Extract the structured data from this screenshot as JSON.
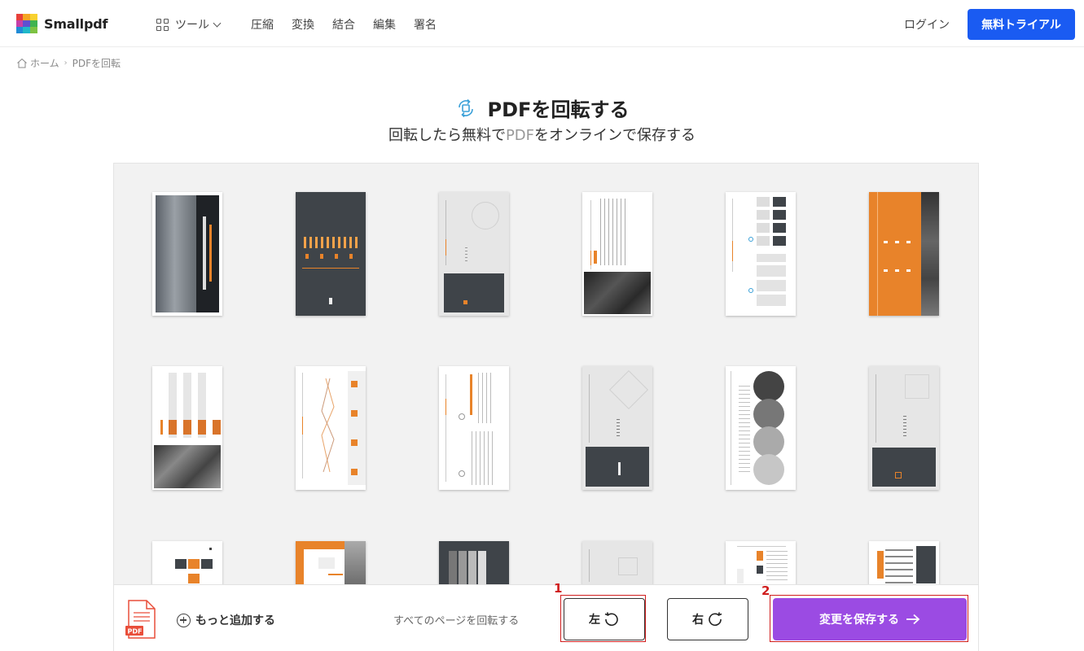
{
  "brand": {
    "name": "Smallpdf"
  },
  "nav": {
    "tools_label": "ツール",
    "links": [
      "圧縮",
      "変換",
      "結合",
      "編集",
      "署名"
    ],
    "login": "ログイン",
    "trial": "無料トライアル"
  },
  "breadcrumb": {
    "home": "ホーム",
    "current": "PDFを回転"
  },
  "header": {
    "title": "PDFを回転する",
    "subtitle_pre": "回転したら無料で",
    "subtitle_pdf": "PDF",
    "subtitle_post": "をオンラインで保存する"
  },
  "toolbar": {
    "add_more": "もっと追加する",
    "rotate_all_label": "すべてのページを回転する",
    "rotate_left": "左",
    "rotate_right": "右",
    "save": "変更を保存する"
  },
  "annotations": {
    "marker1": "1",
    "marker2": "2"
  },
  "colors": {
    "accent": "#9b4be3",
    "brand_blue": "#1a5bf2",
    "highlight": "#d01e1e",
    "slide_orange": "#e8832a",
    "slide_dark": "#3f4449"
  }
}
